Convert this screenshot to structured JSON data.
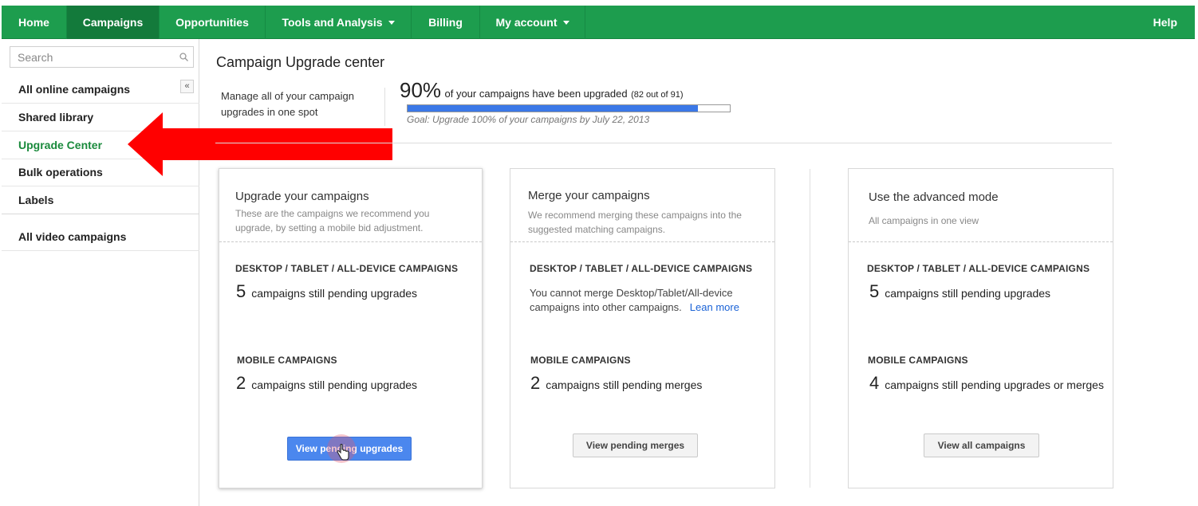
{
  "nav": {
    "items": [
      {
        "label": "Home"
      },
      {
        "label": "Campaigns"
      },
      {
        "label": "Opportunities"
      },
      {
        "label": "Tools and Analysis"
      },
      {
        "label": "Billing"
      },
      {
        "label": "My account"
      }
    ],
    "help": "Help"
  },
  "sidebar": {
    "search_placeholder": "Search",
    "collapse_glyph": "«",
    "items": [
      {
        "label": "All online campaigns"
      },
      {
        "label": "Shared library"
      },
      {
        "label": "Upgrade Center"
      },
      {
        "label": "Bulk operations"
      },
      {
        "label": "Labels"
      },
      {
        "label": "All video campaigns"
      }
    ],
    "active_color": "#1a8a3c"
  },
  "main": {
    "title": "Campaign Upgrade center",
    "summary": "Manage all of your campaign upgrades in one spot",
    "percent": "90%",
    "percent_text": "of your campaigns have been upgraded",
    "percent_count": "(82 out of 91)",
    "progress_value": 0.9,
    "goal": "Goal: Upgrade 100% of your campaigns by July 22, 2013"
  },
  "cards": [
    {
      "title": "Upgrade your campaigns",
      "subtitle": "These are the campaigns we recommend you upgrade, by setting a mobile bid adjustment.",
      "desktop_heading": "DESKTOP  /  TABLET  /  ALL-DEVICE  CAMPAIGNS",
      "desktop_num": "5",
      "desktop_text": "campaigns still pending upgrades",
      "mobile_heading": "MOBILE CAMPAIGNS",
      "mobile_num": "2",
      "mobile_text": "campaigns still pending upgrades",
      "button": "View pending upgrades"
    },
    {
      "title": "Merge your campaigns",
      "subtitle": "We recommend merging these campaigns into the suggested matching campaigns.",
      "desktop_heading": "DESKTOP  /  TABLET  /  ALL-DEVICE  CAMPAIGNS",
      "desktop_note": "You cannot merge Desktop/Tablet/All-device campaigns into other campaigns.",
      "learn_more": "Lean more",
      "mobile_heading": "MOBILE CAMPAIGNS",
      "mobile_num": "2",
      "mobile_text": "campaigns still pending merges",
      "button": "View pending merges"
    },
    {
      "title": "Use the advanced mode",
      "subtitle": "All campaigns in one view",
      "desktop_heading": "DESKTOP  /  TABLET  /  ALL-DEVICE  CAMPAIGNS",
      "desktop_num": "5",
      "desktop_text": "campaigns still pending upgrades",
      "mobile_heading": "MOBILE CAMPAIGNS",
      "mobile_num": "4",
      "mobile_text": "campaigns still pending upgrades or merges",
      "button": "View all campaigns"
    }
  ],
  "colors": {
    "nav_green": "#1d9d4e",
    "nav_active": "#137a3b",
    "primary_button": "#4b87ee",
    "progress_blue": "#3b78e7",
    "annotation_arrow": "#ff0000"
  },
  "icons": [
    "search-icon",
    "collapse-icon",
    "chevron-down-icon",
    "red-arrow",
    "hand-cursor-icon"
  ]
}
